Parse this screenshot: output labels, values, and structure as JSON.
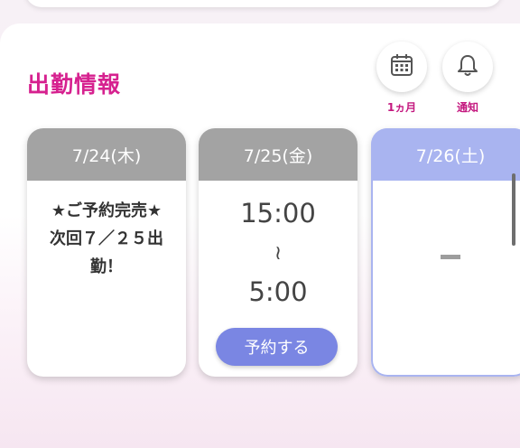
{
  "section": {
    "title": "出勤情報"
  },
  "actions": [
    {
      "label": "1ヵ月",
      "icon": "calendar-icon"
    },
    {
      "label": "通知",
      "icon": "bell-icon"
    }
  ],
  "days": [
    {
      "date": "7/24(木)",
      "note_lines": [
        "★ご予約完売★",
        "次回７／２５出",
        "勤！"
      ]
    },
    {
      "date": "7/25(金)",
      "start": "15:00",
      "separator": "≀",
      "end": "5:00",
      "button": "予約する"
    },
    {
      "date": "7/26(土)",
      "placeholder": "-"
    }
  ],
  "colors": {
    "title": "#d6218f",
    "header_gray": "#a3a3a3",
    "header_blue": "#a9b4f0",
    "button": "#7a86e3"
  }
}
